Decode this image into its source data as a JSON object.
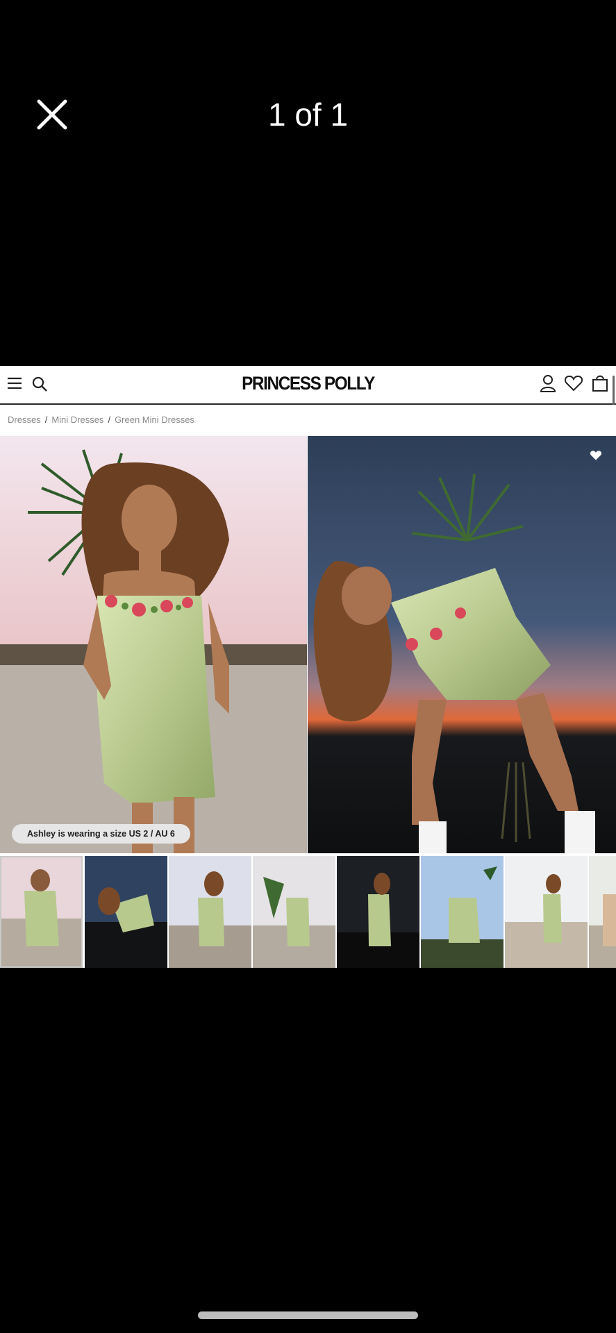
{
  "viewer": {
    "counter": "1 of 1"
  },
  "site": {
    "logo": "PRINCESS POLLY",
    "breadcrumb": [
      "Dresses",
      "Mini Dresses",
      "Green Mini Dresses"
    ]
  },
  "product": {
    "size_note": "Ashley is wearing a size US 2 / AU 6",
    "dress_color": "#b8c98e"
  },
  "thumbnails": [
    {
      "name": "thumbnail-1"
    },
    {
      "name": "thumbnail-2"
    },
    {
      "name": "thumbnail-3"
    },
    {
      "name": "thumbnail-4"
    },
    {
      "name": "thumbnail-5"
    },
    {
      "name": "thumbnail-6"
    },
    {
      "name": "thumbnail-7"
    },
    {
      "name": "thumbnail-8"
    }
  ]
}
